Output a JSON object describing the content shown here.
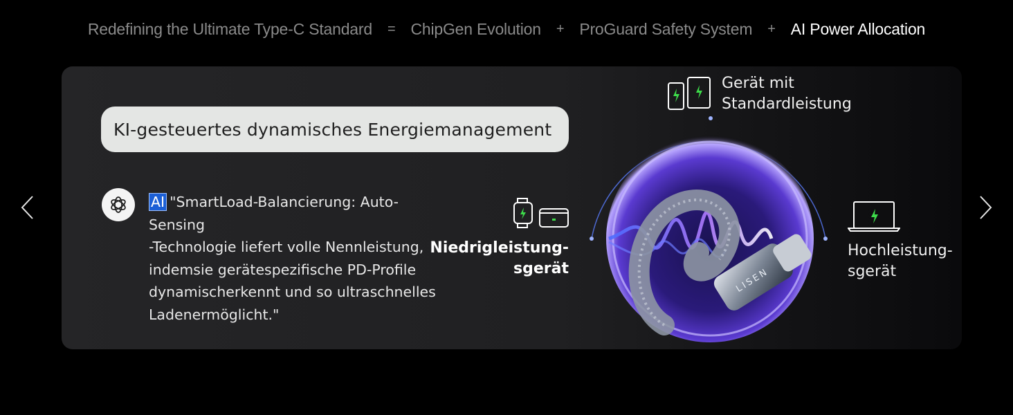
{
  "nav": {
    "items": [
      {
        "label": "Redefining the Ultimate Type-C Standard",
        "active": false
      },
      {
        "label": "ChipGen Evolution",
        "active": false
      },
      {
        "label": "ProGuard Safety System",
        "active": false
      },
      {
        "label": "AI Power Allocation",
        "active": true
      }
    ],
    "separators": [
      "=",
      "+",
      "+"
    ]
  },
  "card": {
    "heading": "KI-gesteuertes dynamisches Energiemanagement",
    "ai_tag": "AI",
    "quote_lines": [
      "\"SmartLoad-Balancierung: Auto-Sensing",
      "-Technologie liefert volle Nennleistung,",
      "indemsie gerätespezifische PD-Profile",
      "dynamischerkennt und so ultraschnelles",
      "Ladenermöglicht.\""
    ],
    "labels": {
      "standard": [
        "Gerät mit",
        "Standardleistung"
      ],
      "low": [
        "Niedrigleistung-",
        "sgerät"
      ],
      "high": [
        "Hochleistung-",
        "sgerät"
      ]
    },
    "brand": "LISEN"
  },
  "colors": {
    "accent_blue": "#1b5fd6",
    "charge_green": "#3ddc4a",
    "glow_purple": "#8a4dff"
  },
  "icons": [
    "chevron-left-icon",
    "chevron-right-icon",
    "chatgpt-icon",
    "phone-icon",
    "tablet-icon",
    "watch-icon",
    "card-icon",
    "laptop-icon"
  ]
}
